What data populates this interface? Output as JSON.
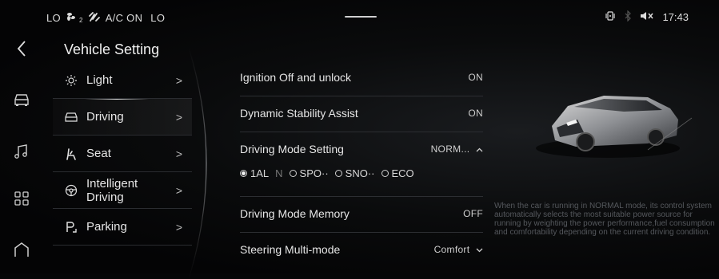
{
  "status_bar": {
    "left_temp": "LO",
    "fan_level": "2",
    "ac_label": "A/C ON",
    "right_temp": "LO",
    "time": "17:43"
  },
  "page_title": "Vehicle Setting",
  "menu": [
    {
      "label": "Light",
      "icon": "sun-icon"
    },
    {
      "label": "Driving",
      "icon": "car-icon"
    },
    {
      "label": "Seat",
      "icon": "seat-icon"
    },
    {
      "label": "Intelligent Driving",
      "label_line1": "Intelligent",
      "label_line2": "Driving",
      "icon": "steering-wheel-icon"
    },
    {
      "label": "Parking",
      "icon": "parking-icon"
    }
  ],
  "settings": [
    {
      "label": "Ignition Off and unlock",
      "value": "ON"
    },
    {
      "label": "Dynamic Stability Assist",
      "value": "ON"
    },
    {
      "label": "Driving Mode Setting",
      "value": "NORM..."
    },
    {
      "label": "Driving Mode Memory",
      "value": "OFF"
    },
    {
      "label": "Steering Multi-mode",
      "value": "Comfort"
    }
  ],
  "driving_modes": [
    {
      "label": "1AL",
      "selected": true
    },
    {
      "label": "SPO··",
      "selected": false
    },
    {
      "label": "SNO··",
      "selected": false
    },
    {
      "label": "ECO",
      "selected": false
    }
  ],
  "description": "When the car is running in NORMAL mode, its control system automatically selects the most suitable power source for running by weighting the power performance,fuel consumption and comfortability depending on the current driving condition.",
  "colors": {
    "accent": "#e6e6e6",
    "background": "#050607",
    "muted": "#55585d"
  }
}
